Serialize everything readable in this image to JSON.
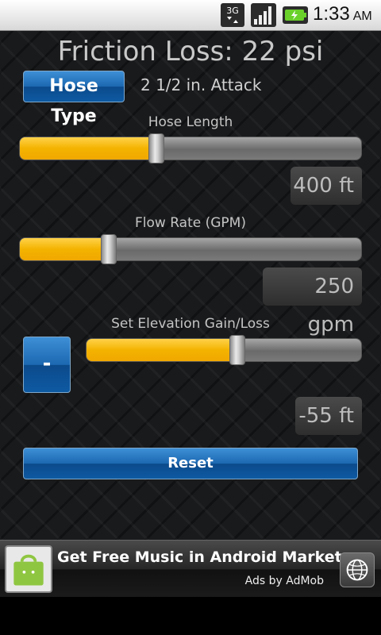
{
  "status_bar": {
    "network_label": "3G",
    "time": "1:33",
    "ampm": "AM"
  },
  "title": "Friction Loss: 22 psi",
  "hose_type": {
    "button_label": "Hose Type",
    "value": "2 1/2 in. Attack"
  },
  "hose_length": {
    "label": "Hose Length",
    "readout": "400 ft",
    "slider_fraction": 0.4
  },
  "flow_rate": {
    "label": "Flow Rate (GPM)",
    "readout": "250 gpm",
    "slider_fraction": 0.26
  },
  "elevation": {
    "label": "Set Elevation Gain/Loss",
    "minus_label": "-",
    "readout": "-55 ft",
    "slider_fraction": 0.55
  },
  "reset_label": "Reset",
  "ad": {
    "text": "Get Free Music in Android Market",
    "credit": "Ads by AdMob"
  },
  "colors": {
    "slider_fill": "#f4b300",
    "button_blue": "#1c68b1"
  },
  "icons": [
    "3g-data-icon",
    "signal-strength-icon",
    "battery-charging-icon",
    "android-market-bag-icon",
    "globe-icon"
  ]
}
